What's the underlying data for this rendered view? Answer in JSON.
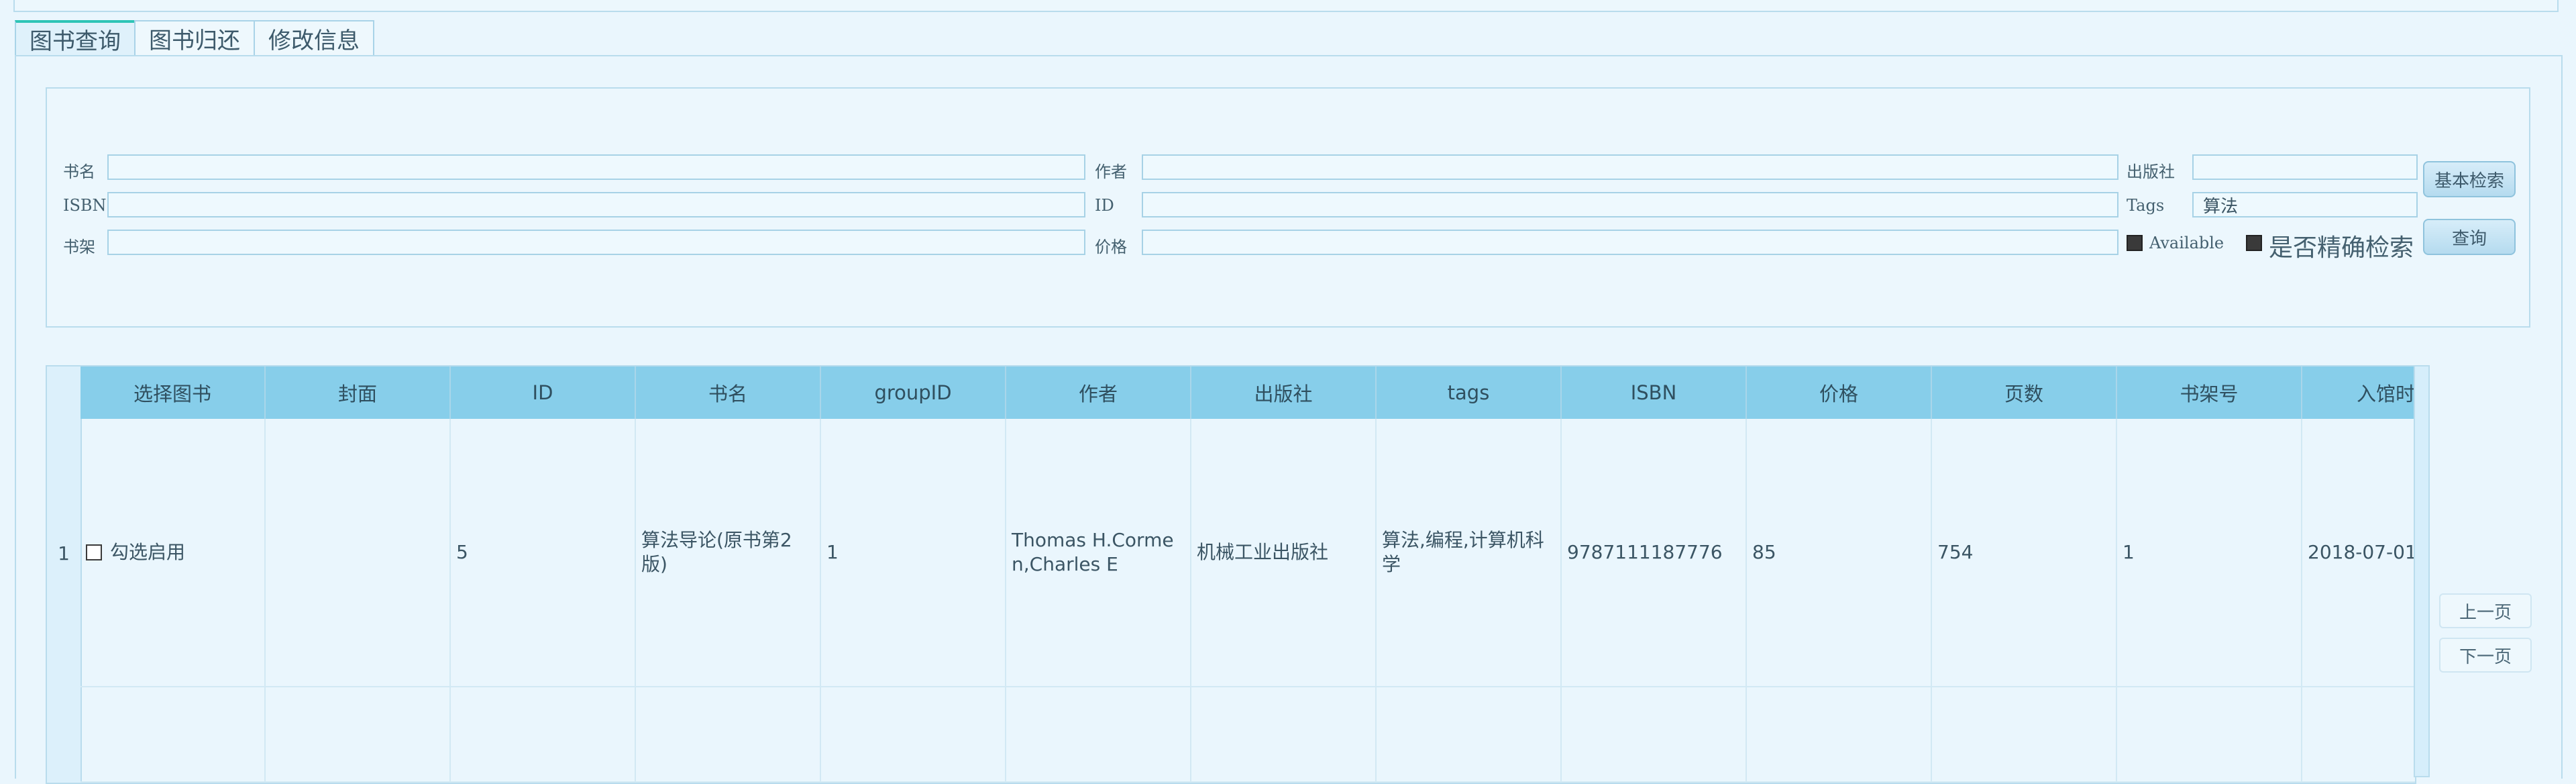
{
  "tabs": [
    {
      "label": "图书查询"
    },
    {
      "label": "图书归还"
    },
    {
      "label": "修改信息"
    }
  ],
  "search": {
    "labels": {
      "title": "书名",
      "author": "作者",
      "publisher": "出版社",
      "isbn": "ISBN",
      "id": "ID",
      "tags": "Tags",
      "shelf": "书架",
      "price": "价格",
      "available": "Available",
      "exact": "是否精确检索"
    },
    "values": {
      "tags": "算法"
    },
    "buttons": {
      "basic": "基本检索",
      "query": "查询"
    }
  },
  "table": {
    "columns": [
      "选择图书",
      "封面",
      "ID",
      "书名",
      "groupID",
      "作者",
      "出版社",
      "tags",
      "ISBN",
      "价格",
      "页数",
      "书架号",
      "入馆时"
    ],
    "rows": [
      {
        "num": "1",
        "select_label": "勾选启用",
        "cover": "",
        "id": "5",
        "title": "算法导论(原书第2版)",
        "group_id": "1",
        "author": "Thomas H.Cormen,Charles E",
        "publisher": "机械工业出版社",
        "tags": "算法,编程,计算机科学",
        "isbn": "9787111187776",
        "price": "85",
        "pages": "754",
        "shelf": "1",
        "date": "2018-07-01"
      }
    ]
  },
  "pager": {
    "prev": "上一页",
    "next": "下一页"
  }
}
